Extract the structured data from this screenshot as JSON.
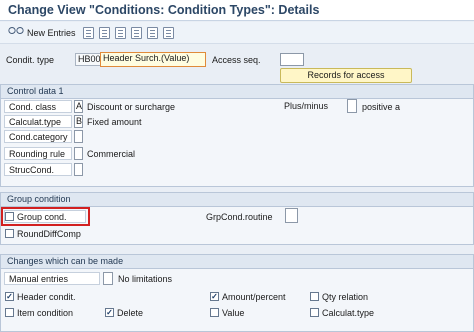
{
  "title": "Change View \"Conditions: Condition Types\": Details",
  "toolbar": {
    "new_entries_label": "New Entries"
  },
  "header_fields": {
    "condit_type_label": "Condit. type",
    "condit_type_value": "HB00",
    "condit_type_desc": "Header Surch.(Value)",
    "access_seq_label": "Access seq.",
    "access_seq_value": "",
    "records_button": "Records for access"
  },
  "control_data": {
    "title": "Control data 1",
    "cond_class_label": "Cond. class",
    "cond_class_code": "A",
    "cond_class_text": "Discount or surcharge",
    "plus_minus_label": "Plus/minus",
    "plus_minus_text": "positive a",
    "calculat_type_label": "Calculat.type",
    "calculat_type_code": "B",
    "calculat_type_text": "Fixed amount",
    "cond_category_label": "Cond.category",
    "rounding_rule_label": "Rounding rule",
    "rounding_rule_text": "Commercial",
    "struc_cond_label": "StrucCond."
  },
  "group_condition": {
    "title": "Group condition",
    "group_cond_label": "Group cond.",
    "group_cond_checked": false,
    "round_diff_label": "RoundDiffComp",
    "round_diff_checked": false,
    "grp_cond_routine_label": "GrpCond.routine"
  },
  "changes": {
    "title": "Changes which can be made",
    "manual_entries_label": "Manual entries",
    "manual_entries_text": "No limitations",
    "header_condit_label": "Header condit.",
    "header_condit_checked": true,
    "amount_percent_label": "Amount/percent",
    "amount_percent_checked": true,
    "qty_relation_label": "Qty relation",
    "qty_relation_checked": false,
    "item_condition_label": "Item condition",
    "item_condition_checked": false,
    "delete_label": "Delete",
    "delete_checked": true,
    "value_label": "Value",
    "value_checked": false,
    "calculat_type_label": "Calculat.type",
    "calculat_type_checked": false
  },
  "colors": {
    "title_text": "#2c4766",
    "group_header_bg": "#dfe7f1",
    "highlight_box": "#d22020",
    "button_bg": "#fff6c7"
  }
}
